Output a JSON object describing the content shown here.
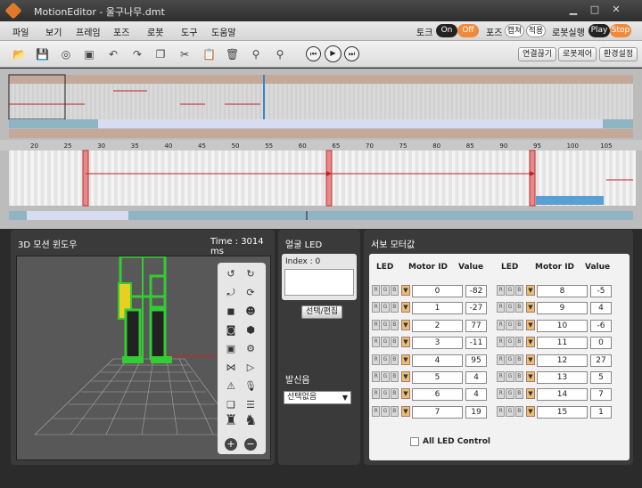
{
  "window": {
    "title": "MotionEditor - 울구나무.dmt",
    "min": "▁",
    "max": "□",
    "close": "✕"
  },
  "menu": [
    "파일",
    "보기",
    "프레임",
    "포즈",
    "로봇",
    "도구",
    "도움말"
  ],
  "torque": {
    "label": "토크",
    "on": "On",
    "off": "Off"
  },
  "pose": {
    "label": "포즈",
    "capture": "캡쳐",
    "apply": "적용"
  },
  "robot_run": {
    "label": "로봇실행",
    "play": "Play",
    "stop": "Stop"
  },
  "toolbar": {
    "icons": [
      "open-icon",
      "save-icon",
      "settings-icon",
      "export-icon",
      "undo-icon",
      "redo-icon",
      "copy-frame-icon",
      "cut-icon",
      "paste-icon",
      "delete-icon",
      "search-icon",
      "zoom-icon"
    ],
    "transport": [
      "prev-icon",
      "play-icon",
      "next-icon"
    ],
    "buttons": [
      "연결끊기",
      "로봇제어",
      "환경설정"
    ]
  },
  "ruler": [
    "20",
    "25",
    "30",
    "35",
    "40",
    "45",
    "50",
    "55",
    "60",
    "65",
    "70",
    "75",
    "80",
    "85",
    "90",
    "95",
    "100",
    "105"
  ],
  "viewport": {
    "title": "3D 모션 윈도우",
    "time": "Time : 3014 ms"
  },
  "led": {
    "title": "얼굴 LED",
    "index": "Index : 0",
    "select_btn": "선택/편집",
    "blink_label": "발신음",
    "blink_value": "선택없음"
  },
  "servo": {
    "title": "서보 모터값",
    "headers": [
      "LED",
      "Motor ID",
      "Value",
      "LED",
      "Motor ID",
      "Value"
    ],
    "left": [
      {
        "id": "0",
        "v": "-82"
      },
      {
        "id": "1",
        "v": "-27"
      },
      {
        "id": "2",
        "v": "77"
      },
      {
        "id": "3",
        "v": "-11"
      },
      {
        "id": "4",
        "v": "95"
      },
      {
        "id": "5",
        "v": "4"
      },
      {
        "id": "6",
        "v": "4"
      },
      {
        "id": "7",
        "v": "19"
      }
    ],
    "right": [
      {
        "id": "8",
        "v": "-5"
      },
      {
        "id": "9",
        "v": "4"
      },
      {
        "id": "10",
        "v": "-6"
      },
      {
        "id": "11",
        "v": "0"
      },
      {
        "id": "12",
        "v": "27"
      },
      {
        "id": "13",
        "v": "5"
      },
      {
        "id": "14",
        "v": "7"
      },
      {
        "id": "15",
        "v": "1"
      }
    ],
    "all_led": "All LED Control"
  },
  "colors": {
    "accent": "#e07a2a",
    "timeline_bar": "#b89c8c",
    "keyframe": "#e88888",
    "selected": "#5a9fd4",
    "robot_green": "#33cc33",
    "robot_yellow": "#e8d020"
  }
}
